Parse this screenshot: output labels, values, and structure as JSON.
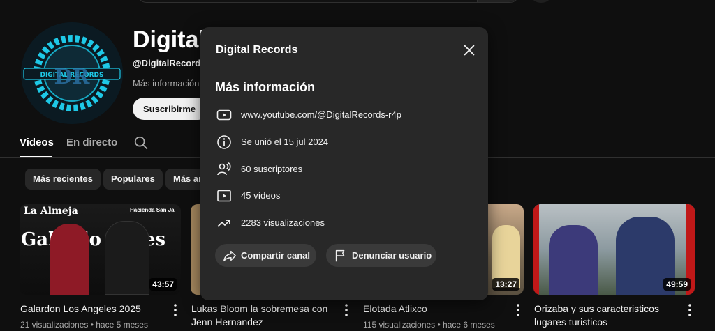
{
  "channel": {
    "name": "Digital",
    "handle": "@DigitalRecords",
    "more_info_link": "Más información",
    "subscribe_label": "Suscribirme",
    "avatar_text": "DIGITAL RECORDS"
  },
  "tabs": [
    {
      "label": "Videos",
      "active": true
    },
    {
      "label": "En directo",
      "active": false
    }
  ],
  "chips": [
    "Más recientes",
    "Populares",
    "Más antiguos"
  ],
  "videos": [
    {
      "title_lines": [
        "Galardon Los Angeles 2025"
      ],
      "meta": "21 visualizaciones • hace 5 meses",
      "duration": "43:57",
      "thumb_texts": [
        "La Almeja",
        "Galardo",
        "les",
        "Hacienda San Ja"
      ]
    },
    {
      "title_lines": [
        "Lukas Bloom la sobremesa con",
        "Jenn Hernandez"
      ],
      "meta": "",
      "duration": "",
      "thumb_texts": []
    },
    {
      "title_lines": [
        "Elotada Atlixco"
      ],
      "meta": "115 visualizaciones • hace 6 meses",
      "duration": "13:27",
      "thumb_texts": []
    },
    {
      "title_lines": [
        "Orizaba y sus caracteristicos",
        "lugares turisticos"
      ],
      "meta": "",
      "duration": "49:59",
      "thumb_texts": []
    }
  ],
  "modal": {
    "title": "Digital Records",
    "heading": "Más información",
    "rows": [
      {
        "icon": "youtube-icon",
        "text": "www.youtube.com/@DigitalRecords-r4p"
      },
      {
        "icon": "info-icon",
        "text": "Se unió el 15 jul 2024"
      },
      {
        "icon": "subscribers-icon",
        "text": "60 suscriptores"
      },
      {
        "icon": "video-icon",
        "text": "45 vídeos"
      },
      {
        "icon": "trending-icon",
        "text": "2283 visualizaciones"
      }
    ],
    "share_label": "Compartir canal",
    "report_label": "Denunciar usuario"
  },
  "colors": {
    "background": "#0f0f0f",
    "modal_background": "#282828",
    "chip_background": "#272727",
    "text_primary": "#f1f1f1",
    "text_secondary": "#aaaaaa",
    "avatar_accent": "#1ec8e6"
  }
}
